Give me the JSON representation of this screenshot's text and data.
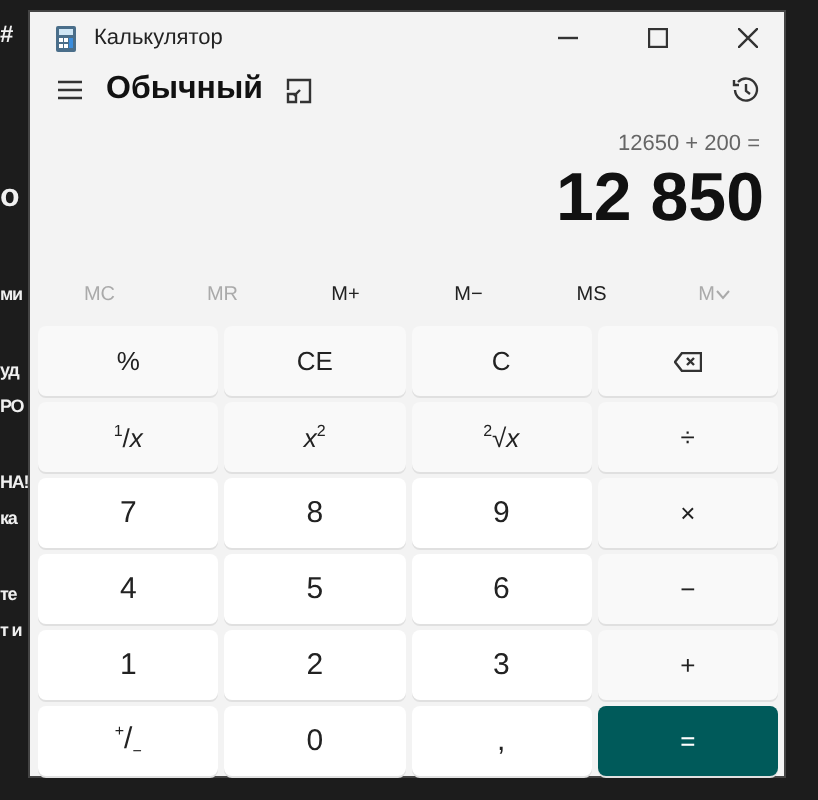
{
  "background": {
    "fragments": [
      {
        "text": "#",
        "kind": "tag"
      },
      {
        "text": "о",
        "kind": "heading"
      },
      {
        "text": "ми",
        "kind": "line"
      },
      {
        "text": "уд",
        "kind": "line"
      },
      {
        "text": "РО",
        "kind": "line"
      },
      {
        "text": "НА!",
        "kind": "line"
      },
      {
        "text": "ка",
        "kind": "line"
      },
      {
        "text": "те",
        "kind": "line"
      },
      {
        "text": "т и",
        "kind": "line"
      }
    ]
  },
  "window": {
    "title": "Калькулятор"
  },
  "header": {
    "mode": "Обычный"
  },
  "display": {
    "expression": "12650 + 200 =",
    "result": "12 850"
  },
  "memory": [
    {
      "label": "MC",
      "disabled": true
    },
    {
      "label": "MR",
      "disabled": true
    },
    {
      "label": "M+",
      "disabled": false
    },
    {
      "label": "M−",
      "disabled": false
    },
    {
      "label": "MS",
      "disabled": false
    },
    {
      "label": "M",
      "disabled": true,
      "kind": "dropdown"
    }
  ],
  "keys": [
    {
      "label": "%",
      "kind": "function"
    },
    {
      "label": "CE",
      "kind": "function"
    },
    {
      "label": "C",
      "kind": "function"
    },
    {
      "kind": "backspace"
    },
    {
      "label": "$^{1}$/*x*",
      "kind": "function"
    },
    {
      "label": "*x*$^{2}$",
      "kind": "function"
    },
    {
      "label": "$^{2}$√*x*",
      "kind": "function"
    },
    {
      "label": "÷",
      "kind": "operator"
    },
    {
      "label": "7",
      "kind": "digit"
    },
    {
      "label": "8",
      "kind": "digit"
    },
    {
      "label": "9",
      "kind": "digit"
    },
    {
      "label": "×",
      "kind": "operator"
    },
    {
      "label": "4",
      "kind": "digit"
    },
    {
      "label": "5",
      "kind": "digit"
    },
    {
      "label": "6",
      "kind": "digit"
    },
    {
      "label": "−",
      "kind": "operator"
    },
    {
      "label": "1",
      "kind": "digit"
    },
    {
      "label": "2",
      "kind": "digit"
    },
    {
      "label": "3",
      "kind": "digit"
    },
    {
      "label": "+",
      "kind": "operator"
    },
    {
      "label": "$^{+}$/$_{−}$",
      "kind": "digit"
    },
    {
      "label": "0",
      "kind": "digit"
    },
    {
      "label": ",",
      "kind": "digit"
    },
    {
      "label": "=",
      "kind": "equals"
    }
  ]
}
